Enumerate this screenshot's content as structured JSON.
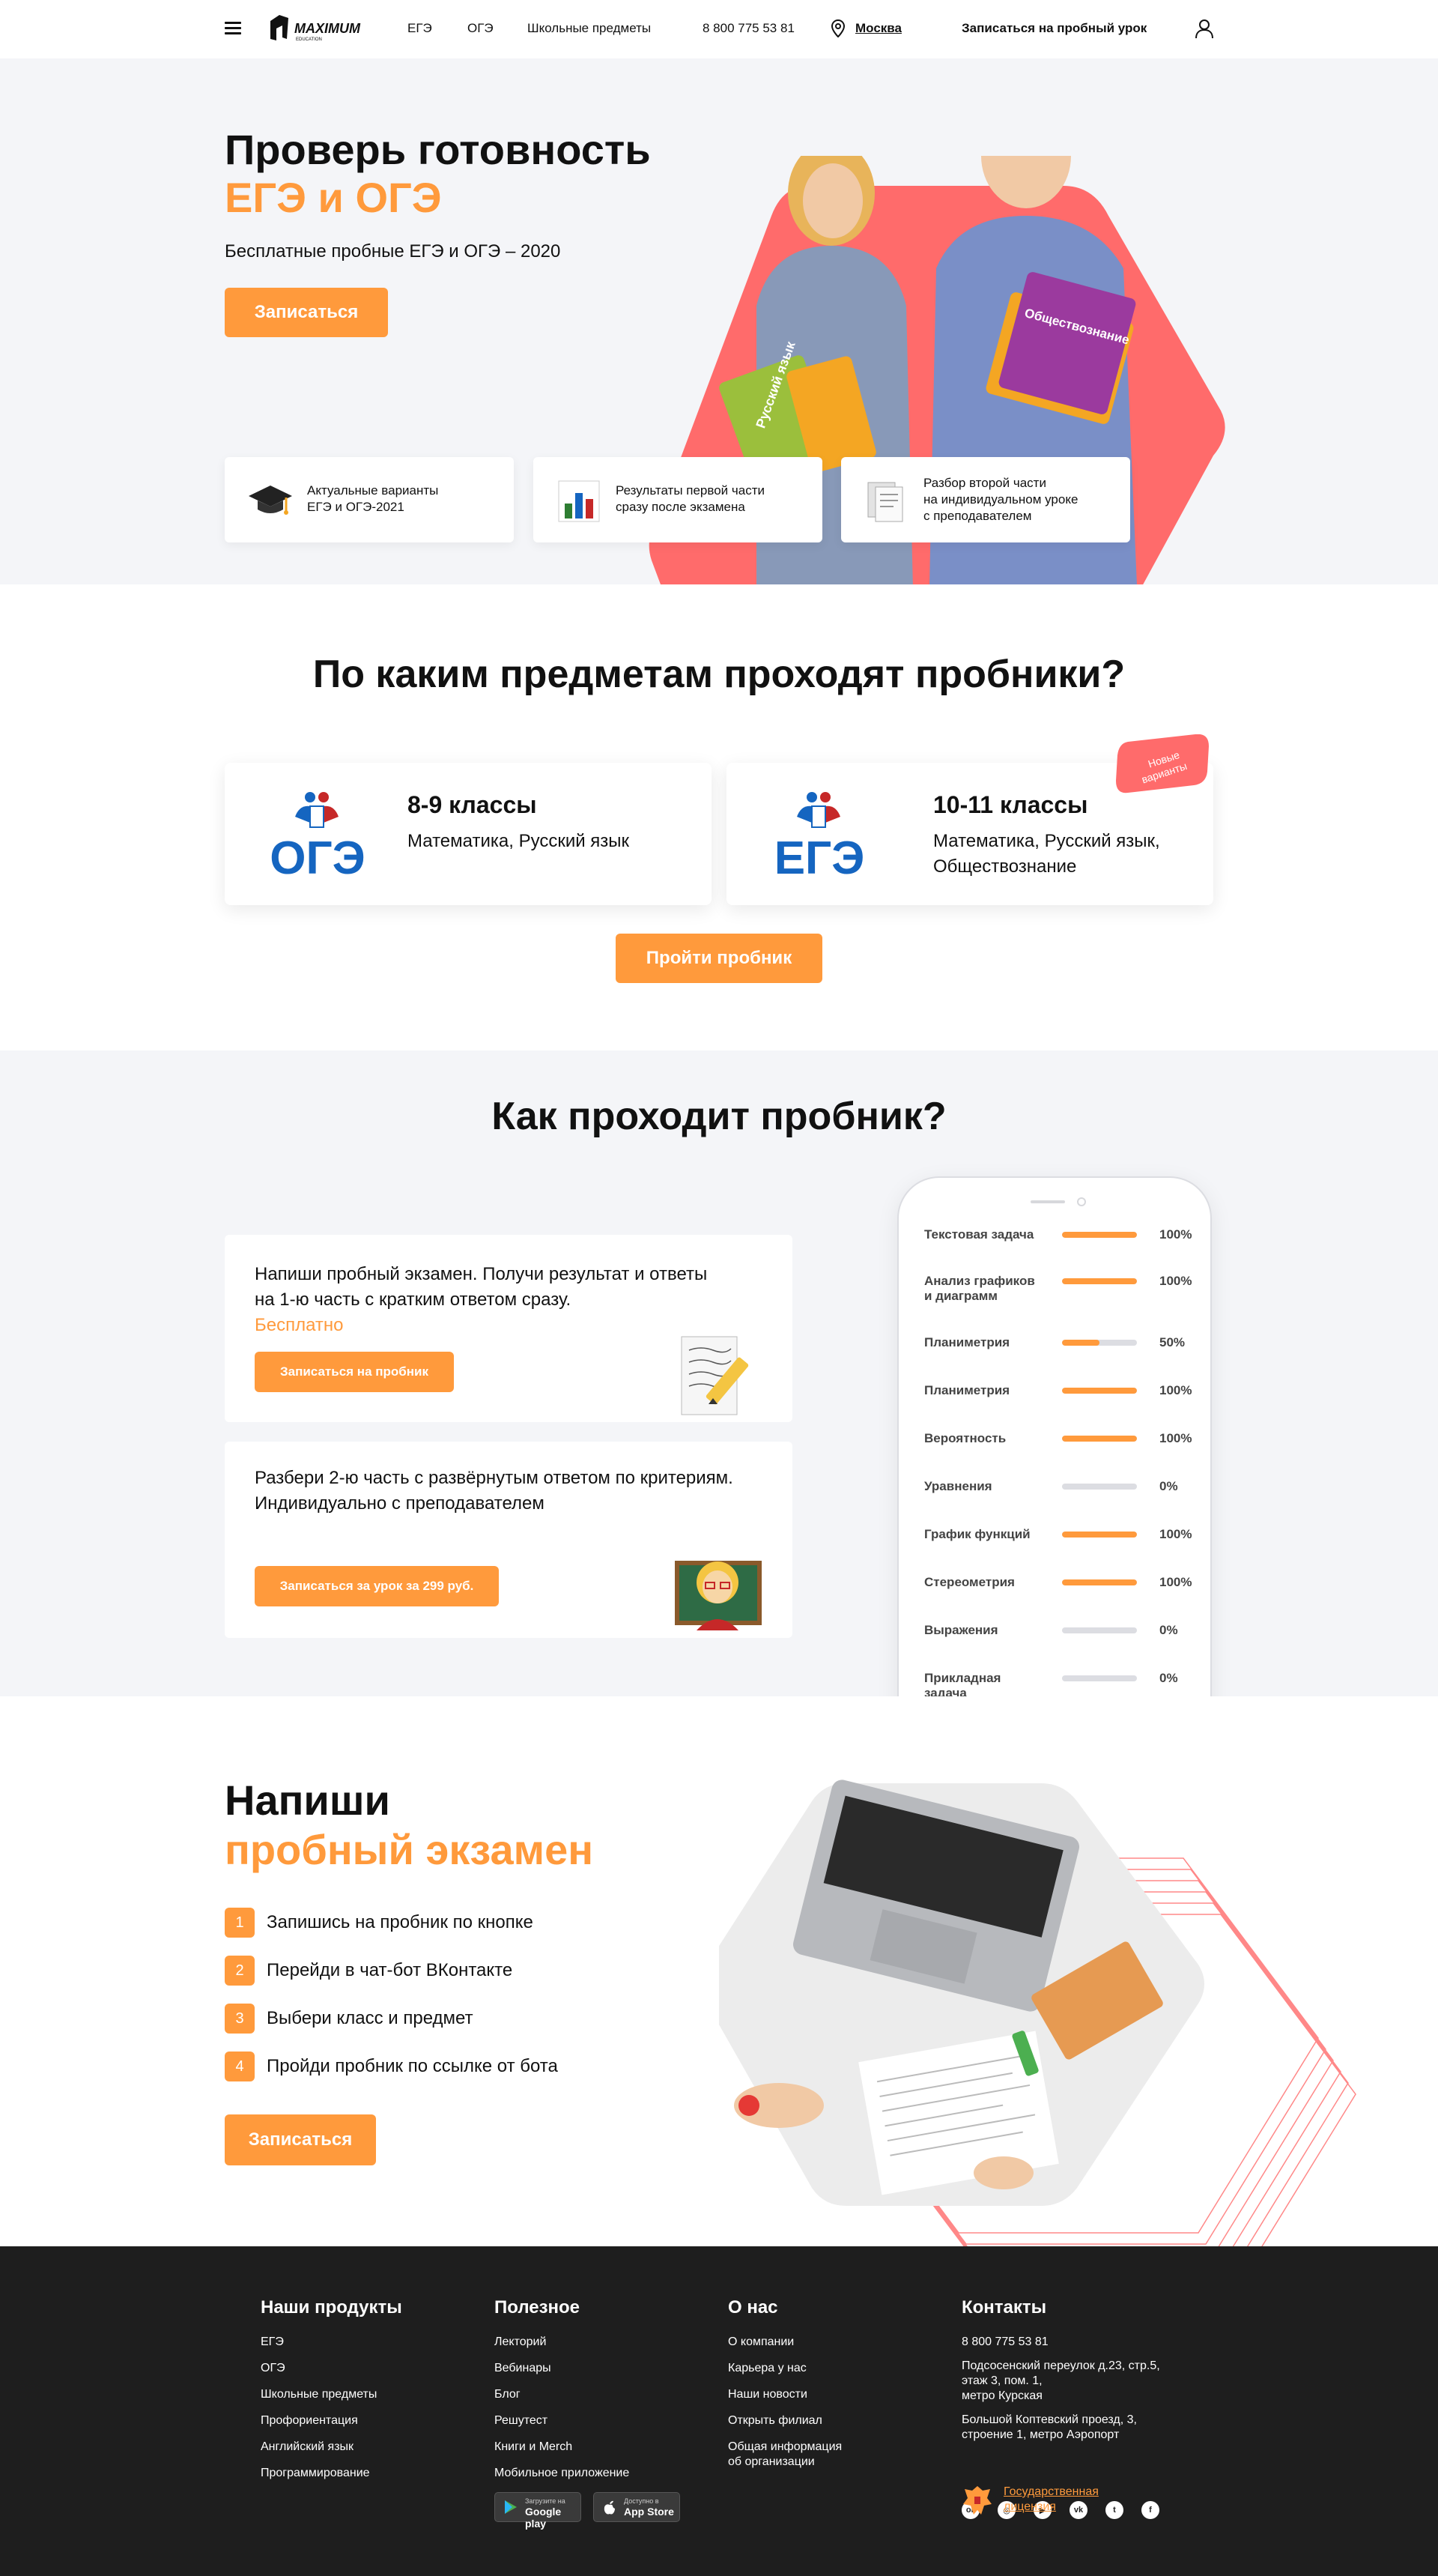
{
  "header": {
    "brand": "MAXIMUM",
    "brand_sub": "EDUCATION",
    "nav": [
      "ЕГЭ",
      "ОГЭ",
      "Школьные предметы"
    ],
    "phone": "8 800 775 53 81",
    "city": "Москва",
    "signup": "Записаться на пробный урок",
    "icons": [
      "menu-icon",
      "location-pin-icon",
      "user-icon"
    ]
  },
  "hero": {
    "title_line1": "Проверь готовность",
    "title_line2": "ЕГЭ и ОГЭ",
    "subtitle": "Бесплатные пробные ЕГЭ и ОГЭ – 2020",
    "cta": "Записаться",
    "book_left": "Русский язык",
    "book_right": "Обществознание",
    "features": [
      {
        "icon": "graduation-cap-icon",
        "text": "Актуальные варианты\nЕГЭ и ОГЭ-2021"
      },
      {
        "icon": "bar-chart-icon",
        "text": "Результаты первой части\nсразу после экзамена"
      },
      {
        "icon": "documents-icon",
        "text": "Разбор второй части\nна индивидуальном уроке\nс преподавателем"
      }
    ]
  },
  "subjects": {
    "title": "По каким предметам проходят пробники?",
    "cards": [
      {
        "exam": "ОГЭ",
        "grade": "8-9 классы",
        "subjects": "Математика, Русский язык"
      },
      {
        "exam": "ЕГЭ",
        "grade": "10-11 классы",
        "subjects": "Математика, Русский язык, Обществознание"
      }
    ],
    "badge_line1": "Новые",
    "badge_line2": "варианты",
    "cta": "Пройти пробник"
  },
  "how": {
    "title": "Как проходит пробник?",
    "steps": [
      {
        "text_line1": "Напиши пробный экзамен. Получи результат и ответы",
        "text_line2": "на 1-ю часть с кратким ответом сразу.",
        "highlight": "Бесплатно",
        "button": "Записаться на пробник",
        "icon": "writing-hand-icon"
      },
      {
        "text_line1": "Разбери 2-ю часть с развёрнутым ответом по критериям.",
        "text_line2": "Индивидуально с преподавателем",
        "button": "Записаться за урок за 299 руб.",
        "icon": "teacher-icon"
      }
    ],
    "results": [
      {
        "name": "Текстовая задача",
        "pct_label": "100%",
        "value": 1.0
      },
      {
        "name": "Анализ графиков и диаграмм",
        "pct_label": "100%",
        "value": 1.0
      },
      {
        "name": "Планиметрия",
        "pct_label": "50%",
        "value": 0.5
      },
      {
        "name": "Планиметрия",
        "pct_label": "100%",
        "value": 1.0
      },
      {
        "name": "Вероятность",
        "pct_label": "100%",
        "value": 1.0
      },
      {
        "name": "Уравнения",
        "pct_label": "0%",
        "value": 0
      },
      {
        "name": "График функций",
        "pct_label": "100%",
        "value": 1.0
      },
      {
        "name": "Стереометрия",
        "pct_label": "100%",
        "value": 1.0
      },
      {
        "name": "Выражения",
        "pct_label": "0%",
        "value": 0
      },
      {
        "name": "Прикладная задача",
        "pct_label": "0%",
        "value": 0
      }
    ]
  },
  "write": {
    "title_line1": "Напиши",
    "title_line2": "пробный экзамен",
    "steps": [
      {
        "num": "1",
        "text": "Запишись на пробник по кнопке"
      },
      {
        "num": "2",
        "text": "Перейди в чат-бот ВКонтакте"
      },
      {
        "num": "3",
        "text": "Выбери класс и предмет"
      },
      {
        "num": "4",
        "text": "Пройди пробник по ссылке от бота"
      }
    ],
    "cta": "Записаться"
  },
  "footer": {
    "products": {
      "title": "Наши продукты",
      "links": [
        "ЕГЭ",
        "ОГЭ",
        "Школьные предметы",
        "Профориентация",
        "Английский язык",
        "Программирование"
      ]
    },
    "useful": {
      "title": "Полезное",
      "links": [
        "Лекторий",
        "Вебинары",
        "Блог",
        "Решутест",
        "Книги и Merch",
        "Мобильное приложение"
      ]
    },
    "about": {
      "title": "О нас",
      "links": [
        "О компании",
        "Карьера у нас",
        "Наши новости",
        "Открыть филиал",
        "Общая информация\nоб организации"
      ]
    },
    "contacts": {
      "title": "Контакты",
      "phone": "8 800 775 53 81",
      "address1": "Подсосенский переулок д.23, стр.5,\nэтаж 3,  пом. 1,\nметро Курская",
      "address2": "Большой Коптевский проезд, 3,\nстроение 1, метро Аэропорт",
      "license": "Государственная\nлицензия"
    },
    "google_play_small": "Загрузите на",
    "google_play": "Google play",
    "app_store_small": "Доступно в",
    "app_store": "App Store",
    "social": [
      "ok-icon",
      "instagram-icon",
      "youtube-icon",
      "vk-icon",
      "twitter-icon",
      "facebook-icon"
    ],
    "social_glyphs": [
      "ок",
      "◎",
      "▶",
      "vk",
      "t",
      "f"
    ]
  },
  "colors": {
    "accent": "#ff9a3c",
    "coral": "#ff6b6b",
    "dark": "#1e1e1e",
    "light_bg": "#f4f5f8",
    "blue": "#1565c0"
  }
}
